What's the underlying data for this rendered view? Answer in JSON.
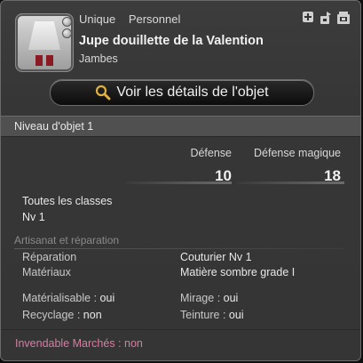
{
  "item": {
    "tags": [
      "Unique",
      "Personnel"
    ],
    "name": "Jupe douillette de la Valention",
    "category": "Jambes"
  },
  "header_icons": [
    "plus-icon",
    "arrow-icon",
    "crate-icon"
  ],
  "details_button": {
    "label": "Voir les détails de l'objet",
    "icon": "magnifier-icon"
  },
  "item_level": "Niveau d'objet 1",
  "stats": {
    "defense_label": "Défense",
    "defense_value": "10",
    "magic_defense_label": "Défense magique",
    "magic_defense_value": "18"
  },
  "classes": "Toutes les classes",
  "level": "Nv 1",
  "crafting": {
    "title": "Artisanat et réparation",
    "repair_label": "Réparation",
    "repair_value": "Couturier Nv 1",
    "materials_label": "Matériaux",
    "materials_value": "Matière sombre grade I"
  },
  "properties": {
    "materialize_label": "Matérialisable",
    "materialize_value": "oui",
    "mirage_label": "Mirage",
    "mirage_value": "oui",
    "recycle_label": "Recyclage",
    "recycle_value": "non",
    "dye_label": "Teinture",
    "dye_value": "oui",
    "separator": " : "
  },
  "market": {
    "label": "Invendable Marchés",
    "separator": " : ",
    "value": "non"
  },
  "colors": {
    "market_text": "#d67ea0",
    "section_title": "#8a8a8a"
  }
}
